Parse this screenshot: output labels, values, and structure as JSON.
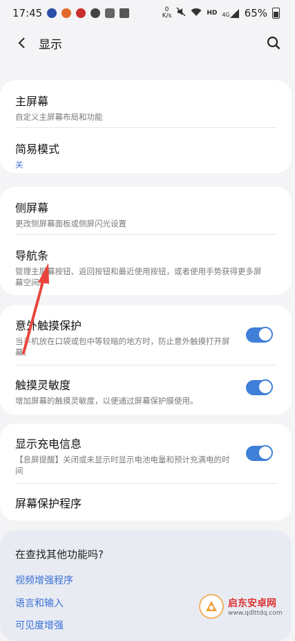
{
  "status_bar": {
    "time": "17:45",
    "net_speed_top": "0",
    "net_speed_unit": "K/s",
    "hd_label": "HD",
    "signal_label": "4G",
    "battery": "65%"
  },
  "header": {
    "title": "显示"
  },
  "sections": [
    {
      "items": [
        {
          "title": "主屏幕",
          "subtitle": "自定义主屏幕布局和功能"
        },
        {
          "title": "简易模式",
          "subtitle": "关"
        }
      ]
    },
    {
      "items": [
        {
          "title": "侧屏幕",
          "subtitle": "更改侧屏幕面板或侧屏闪光设置"
        },
        {
          "title": "导航条",
          "subtitle_l1": "管理主屏幕按钮、返回按钮和最近使用按钮，或者使用手势获得更多屏",
          "subtitle_l2": "幕空间。"
        }
      ]
    },
    {
      "items": [
        {
          "title": "意外触摸保护",
          "subtitle_l1": "当手机放在口袋或包中等较暗的地方时，防止意外触摸打开屏",
          "subtitle_l2": "幕。",
          "toggle": true
        },
        {
          "title": "触摸灵敏度",
          "subtitle": "增加屏幕的触摸灵敏度，以便通过屏幕保护膜使用。",
          "toggle": true
        }
      ]
    },
    {
      "items": [
        {
          "title": "显示充电信息",
          "subtitle_l1": "【息屏提醒】关闭或未显示时显示电池电量和预计充满电的时",
          "subtitle_l2": "间",
          "toggle": true
        },
        {
          "title": "屏幕保护程序"
        }
      ]
    }
  ],
  "footer": {
    "heading": "在查找其他功能吗?",
    "links": [
      "视频增强程序",
      "语言和输入",
      "可见度增强"
    ]
  },
  "watermark": {
    "name": "启东安卓网",
    "url": "www.qdlttdq.com"
  },
  "colors": {
    "accent": "#3f7fd8",
    "link": "#3b6fd6",
    "annotation_arrow": "#e8453c"
  }
}
